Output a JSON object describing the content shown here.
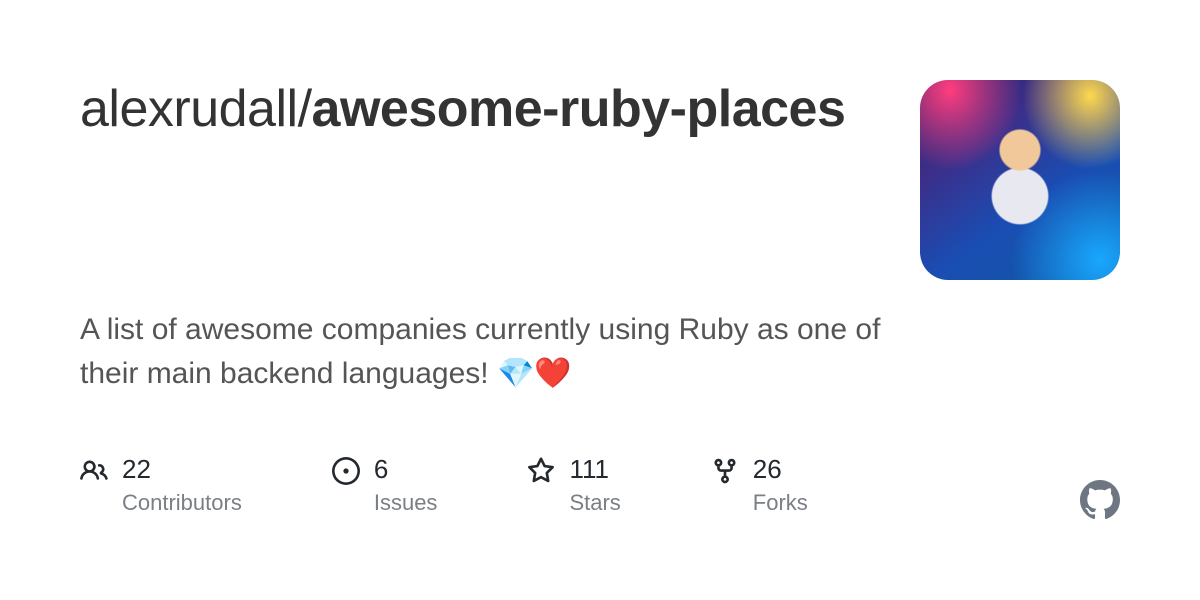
{
  "repo": {
    "owner": "alexrudall",
    "slash": "/",
    "name_part1": "awesome",
    "name_hyphen": "-",
    "name_part2": "ruby-places"
  },
  "description": "A list of awesome companies currently using Ruby as one of their main backend languages! 💎❤️",
  "stats": {
    "contributors": {
      "value": "22",
      "label": "Contributors"
    },
    "issues": {
      "value": "6",
      "label": "Issues"
    },
    "stars": {
      "value": "111",
      "label": "Stars"
    },
    "forks": {
      "value": "26",
      "label": "Forks"
    }
  }
}
